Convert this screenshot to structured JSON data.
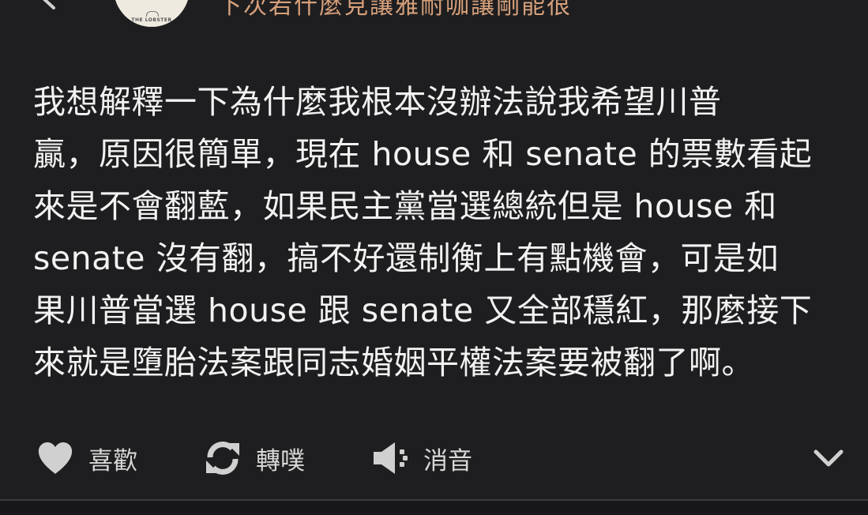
{
  "header": {
    "plurk_name": "下次若什麼見讓雅耐咖讓剛能很",
    "avatar_text": "THE LOBSTER"
  },
  "post": {
    "lines": [
      "我想解釋一下為什麼我根本沒辦法說我希望川普",
      "贏，原因很簡單，現在 house 和 senate 的票數看起",
      "來是不會翻藍，如果民主黨當選總統但是 house 和",
      "senate 沒有翻，搞不好還制衡上有點機會，可是如",
      "果川普當選 house 跟 senate 又全部穩紅，那麼接下",
      "來就是墮胎法案跟同志婚姻平權法案要被翻了啊。"
    ]
  },
  "actions": {
    "like_label": "喜歡",
    "replurk_label": "轉噗",
    "mute_label": "消音"
  },
  "icons": {
    "back": "chevron-left-icon",
    "like": "heart-icon",
    "replurk": "replurk-icon",
    "mute": "speaker-mute-icon",
    "more": "chevron-down-icon"
  },
  "colors": {
    "background": "#1e1e20",
    "text": "#f2f2f2",
    "action_text": "#d8d8d8",
    "icon": "#d0d0d0",
    "name": "#d6a07a"
  }
}
